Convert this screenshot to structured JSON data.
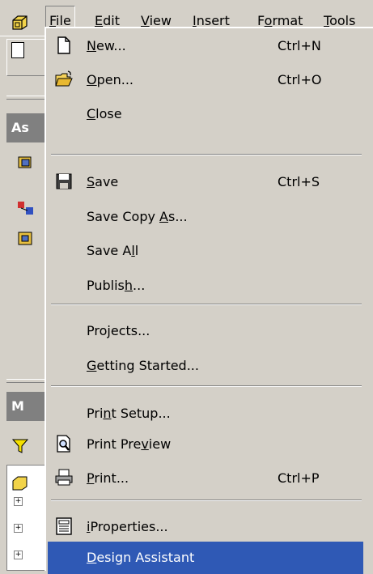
{
  "menubar": {
    "items": [
      {
        "pre": "",
        "u": "F",
        "post": "ile"
      },
      {
        "pre": "",
        "u": "E",
        "post": "dit"
      },
      {
        "pre": "",
        "u": "V",
        "post": "iew"
      },
      {
        "pre": "",
        "u": "I",
        "post": "nsert"
      },
      {
        "pre": "F",
        "u": "o",
        "post": "rmat"
      },
      {
        "pre": "",
        "u": "T",
        "post": "ools"
      }
    ]
  },
  "side": {
    "panel1_label": "As",
    "panel2_label": "M"
  },
  "file_menu": {
    "items": [
      {
        "icon": "new-document-icon",
        "pre": "",
        "u": "N",
        "post": "ew...",
        "shortcut": "Ctrl+N"
      },
      {
        "icon": "open-folder-icon",
        "pre": "",
        "u": "O",
        "post": "pen...",
        "shortcut": "Ctrl+O"
      },
      {
        "icon": "",
        "pre": "",
        "u": "C",
        "post": "lose",
        "shortcut": ""
      },
      {
        "icon": "save-disk-icon",
        "pre": "",
        "u": "S",
        "post": "ave",
        "shortcut": "Ctrl+S"
      },
      {
        "icon": "",
        "pre": "Save Copy ",
        "u": "A",
        "post": "s...",
        "shortcut": ""
      },
      {
        "icon": "",
        "pre": "Save A",
        "u": "l",
        "post": "l",
        "shortcut": ""
      },
      {
        "icon": "",
        "pre": "Publis",
        "u": "h",
        "post": "...",
        "shortcut": ""
      },
      {
        "icon": "",
        "pre": "Pro",
        "u": "j",
        "post": "ects...",
        "shortcut": ""
      },
      {
        "icon": "",
        "pre": "",
        "u": "G",
        "post": "etting Started...",
        "shortcut": ""
      },
      {
        "icon": "",
        "pre": "Pri",
        "u": "n",
        "post": "t Setup...",
        "shortcut": ""
      },
      {
        "icon": "print-preview-icon",
        "pre": "Print Pre",
        "u": "v",
        "post": "iew",
        "shortcut": ""
      },
      {
        "icon": "printer-icon",
        "pre": "",
        "u": "P",
        "post": "rint...",
        "shortcut": "Ctrl+P"
      },
      {
        "icon": "iproperties-icon",
        "pre": "",
        "u": "i",
        "post": "Properties...",
        "shortcut": ""
      },
      {
        "icon": "",
        "pre": "",
        "u": "D",
        "post": "esign Assistant",
        "shortcut": ""
      }
    ]
  },
  "colors": {
    "menu_bg": "#d4d0c8",
    "highlight": "#2f59b5"
  }
}
